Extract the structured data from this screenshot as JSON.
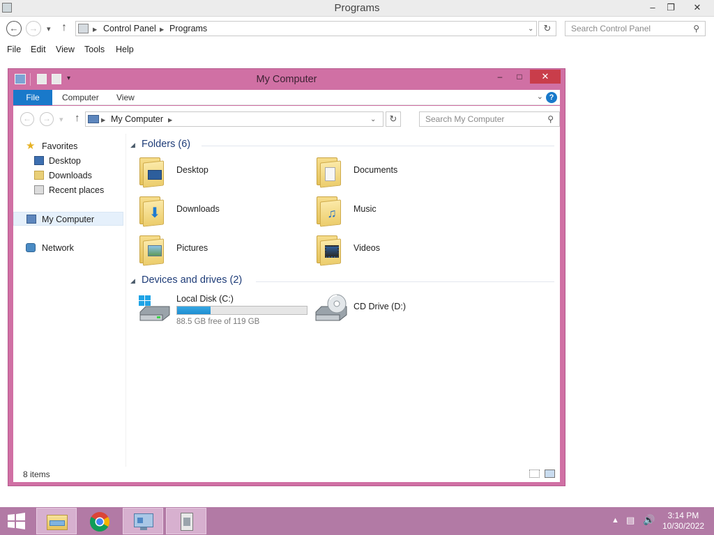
{
  "outer_window": {
    "title": "Programs",
    "breadcrumbs": [
      "Control Panel",
      "Programs"
    ],
    "search_placeholder": "Search Control Panel",
    "menu": [
      "File",
      "Edit",
      "View",
      "Tools",
      "Help"
    ],
    "buttons": {
      "minimize": "–",
      "restore": "❐",
      "close": "✕"
    }
  },
  "explorer": {
    "title": "My Computer",
    "ribbon_tabs": [
      "File",
      "Computer",
      "View"
    ],
    "help_label": "?",
    "breadcrumbs": [
      "My Computer"
    ],
    "search_placeholder": "Search My Computer",
    "nav": {
      "favorites": "Favorites",
      "favorites_items": [
        "Desktop",
        "Downloads",
        "Recent places"
      ],
      "computer": "My Computer",
      "network": "Network"
    },
    "folders_header": "Folders (6)",
    "folders": [
      {
        "name": "Desktop",
        "icon": "desktop-folder-icon"
      },
      {
        "name": "Documents",
        "icon": "documents-folder-icon"
      },
      {
        "name": "Downloads",
        "icon": "downloads-folder-icon"
      },
      {
        "name": "Music",
        "icon": "music-folder-icon"
      },
      {
        "name": "Pictures",
        "icon": "pictures-folder-icon"
      },
      {
        "name": "Videos",
        "icon": "videos-folder-icon"
      }
    ],
    "drives_header": "Devices and drives (2)",
    "drives": [
      {
        "name": "Local Disk (C:)",
        "free_text": "88.5 GB free of 119 GB",
        "used_fraction": 0.256,
        "icon": "local-disk-icon"
      },
      {
        "name": "CD Drive (D:)",
        "icon": "cd-drive-icon"
      }
    ],
    "status": "8 items"
  },
  "taskbar": {
    "time": "3:14 PM",
    "date": "10/30/2022",
    "pinned": [
      "file-explorer-icon",
      "chrome-icon",
      "control-panel-icon",
      "program-icon"
    ]
  },
  "colors": {
    "window_frame": "#d070a4",
    "taskbar": "#b27aa5",
    "accent_blue": "#1979ca",
    "close_red": "#c93d4a"
  }
}
